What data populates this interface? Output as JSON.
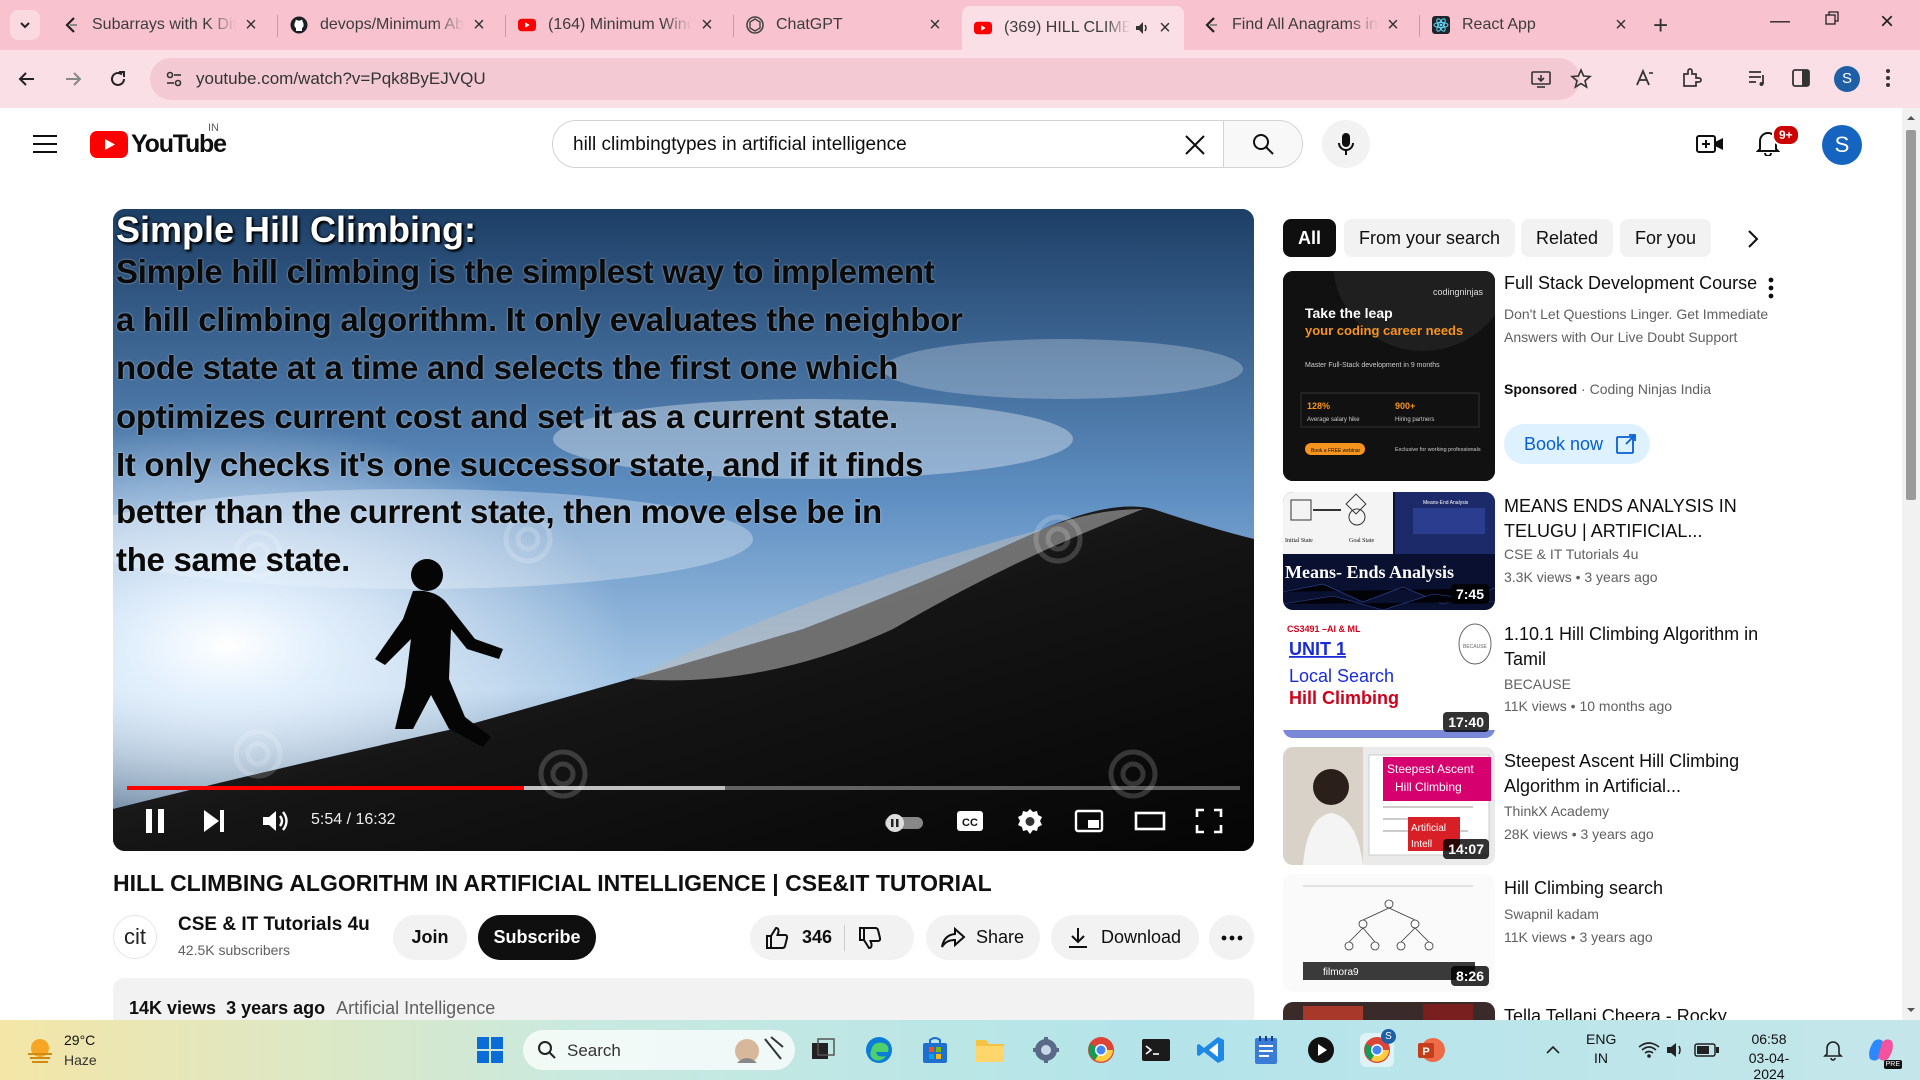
{
  "browser": {
    "tabs": [
      {
        "title": "Subarrays with K Diffe",
        "favicon": "leetcode-icon"
      },
      {
        "title": "devops/Minimum Ab",
        "favicon": "github-icon"
      },
      {
        "title": "(164) Minimum Wind",
        "favicon": "youtube-icon"
      },
      {
        "title": "ChatGPT",
        "favicon": "chatgpt-icon"
      },
      {
        "title": "(369) HILL CLIMB",
        "favicon": "youtube-icon",
        "active": true
      },
      {
        "title": "Find All Anagrams in",
        "favicon": "leetcode-icon"
      },
      {
        "title": "React App",
        "favicon": "react-icon"
      }
    ],
    "url": "youtube.com/watch?v=Pqk8ByEJVQU",
    "profile_initial": "S",
    "theme_color": "#f8c3cf"
  },
  "youtube": {
    "logo_text": "YouTube",
    "country_code": "IN",
    "search_query": "hill climbingtypes in artificial intelligence",
    "notification_badge": "9+",
    "avatar_initial": "S"
  },
  "player": {
    "slide_title": "Simple Hill Climbing:",
    "slide_lines": [
      "Simple hill climbing is the simplest way to implement",
      " a hill climbing algorithm. It only evaluates the neighbor",
      "node state at a time and selects the first one which",
      "optimizes current cost and set it as a current state.",
      "It only checks it's one successor state, and if it finds",
      " better than the current state, then move else be in",
      " the same state."
    ],
    "current_time": "5:54",
    "duration": "16:32",
    "time_display": "5:54 / 16:32",
    "played_fraction": 0.357,
    "buffered_fraction": 0.537
  },
  "video": {
    "title": "HILL CLIMBING ALGORITHM IN ARTIFICIAL INTELLIGENCE | CSE&IT TUTORIAL",
    "channel": "CSE & IT Tutorials 4u",
    "channel_avatar_text": "cit",
    "subscribers": "42.5K subscribers",
    "join_label": "Join",
    "subscribe_label": "Subscribe",
    "likes": "346",
    "share_label": "Share",
    "download_label": "Download",
    "views": "14K views",
    "age": "3 years ago",
    "category": "Artificial Intelligence"
  },
  "sidebar": {
    "chips": [
      "All",
      "From your search",
      "Related",
      "For you"
    ],
    "ad": {
      "title": "Full Stack Development Course",
      "description": "Don't Let Questions Linger. Get Immediate Answers with Our Live Doubt Support",
      "sponsored_label": "Sponsored",
      "advertiser": "Coding Ninjas India",
      "cta": "Book now",
      "thumb_headline_1": "Take the leap",
      "thumb_headline_2": "your coding career needs",
      "thumb_brand": "codingninjas",
      "thumb_sub": "Master Full-Stack development in 9 months",
      "thumb_stat_1": "128%",
      "thumb_stat_1_label": "Average salary hike",
      "thumb_stat_2": "900+",
      "thumb_stat_2_label": "Hiring partners",
      "thumb_button": "Book a FREE webinar",
      "thumb_note": "Exclusive for working professionals"
    },
    "recommendations": [
      {
        "title": "MEANS ENDS ANALYSIS IN TELUGU | ARTIFICIAL...",
        "channel": "CSE & IT Tutorials 4u",
        "meta": "3.3K views • 3 years ago",
        "duration": "7:45",
        "thumb_text": "Means- Ends Analysis",
        "thumb_label_1": "Initial State",
        "thumb_label_2": "Goal State",
        "thumb_label_3": "Means-End Analysis"
      },
      {
        "title": "1.10.1 Hill Climbing Algorithm in Tamil",
        "channel": "BECAUSE",
        "meta": "11K views • 10 months ago",
        "duration": "17:40",
        "thumb_code": "CS3491 –AI & ML",
        "thumb_unit": "UNIT 1",
        "thumb_line1": "Local Search",
        "thumb_line2": "Hill Climbing",
        "thumb_seal": "BECAUSE"
      },
      {
        "title": "Steepest Ascent Hill Climbing Algorithm in Artificial...",
        "channel": "ThinkX Academy",
        "meta": "28K views • 3 years ago",
        "duration": "14:07",
        "thumb_text_1": "Steepest Ascent",
        "thumb_text_2": "Hill Climbing",
        "thumb_text_3": "Artificial",
        "thumb_text_4": "Intell"
      },
      {
        "title": "Hill Climbing search",
        "channel": "Swapnil kadam",
        "meta": "11K views • 3 years ago",
        "duration": "8:26",
        "thumb_watermark": "filmora9"
      },
      {
        "title": "Tella Tellani Cheera - Rocky",
        "channel": "",
        "meta": "",
        "duration": ""
      }
    ]
  },
  "taskbar": {
    "temperature": "29°C",
    "condition": "Haze",
    "search_label": "Search",
    "language_1": "ENG",
    "language_2": "IN",
    "time": "06:58",
    "date": "03-04-2024",
    "chrome_badge": "S",
    "copilot_badge": "PRE"
  }
}
